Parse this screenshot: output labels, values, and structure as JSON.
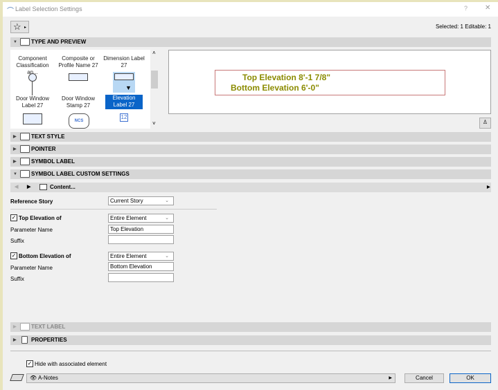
{
  "window": {
    "title": "Label Selection Settings",
    "help": "?",
    "close": "✕"
  },
  "toolbar": {
    "favorites_icon": "star-icon",
    "selection_info": "Selected: 1 Editable: 1"
  },
  "sections": {
    "type_preview": "TYPE AND PREVIEW",
    "text_style": "TEXT STYLE",
    "pointer": "POINTER",
    "symbol_label": "SYMBOL LABEL",
    "custom_settings": "SYMBOL LABEL CUSTOM SETTINGS",
    "text_label": "TEXT LABEL",
    "properties": "PROPERTIES"
  },
  "library": {
    "items": [
      {
        "label": "Component Classification an..."
      },
      {
        "label": "Composite or Profile Name 27"
      },
      {
        "label": "Dimension Label 27"
      },
      {
        "label": "Door Window Label 27"
      },
      {
        "label": "Door Window Stamp 27"
      },
      {
        "label": "Elevation Label 27",
        "selected": true
      }
    ],
    "ncs_badge": "NCS",
    "number_badge": "12"
  },
  "preview": {
    "line1": "Top Elevation  8'-1 7/8\"",
    "line2": "Bottom Elevation  6'-0\"",
    "text_color": "#8b8b00",
    "frame_color": "#c87878"
  },
  "custom": {
    "page_label": "Content...",
    "reference_story_label": "Reference Story",
    "reference_story_value": "Current Story",
    "top": {
      "checked": true,
      "label": "Top Elevation of",
      "value": "Entire Element",
      "param_label": "Parameter Name",
      "param_value": "Top Elevation",
      "suffix_label": "Suffix",
      "suffix_value": ""
    },
    "bottom": {
      "checked": true,
      "label": "Bottom Elevation of",
      "value": "Entire Element",
      "param_label": "Parameter Name",
      "param_value": "Bottom Elevation",
      "suffix_label": "Suffix",
      "suffix_value": ""
    }
  },
  "footer": {
    "hide_checked": true,
    "hide_label": "Hide with associated element",
    "layer": "A-Notes",
    "cancel": "Cancel",
    "ok": "OK"
  }
}
